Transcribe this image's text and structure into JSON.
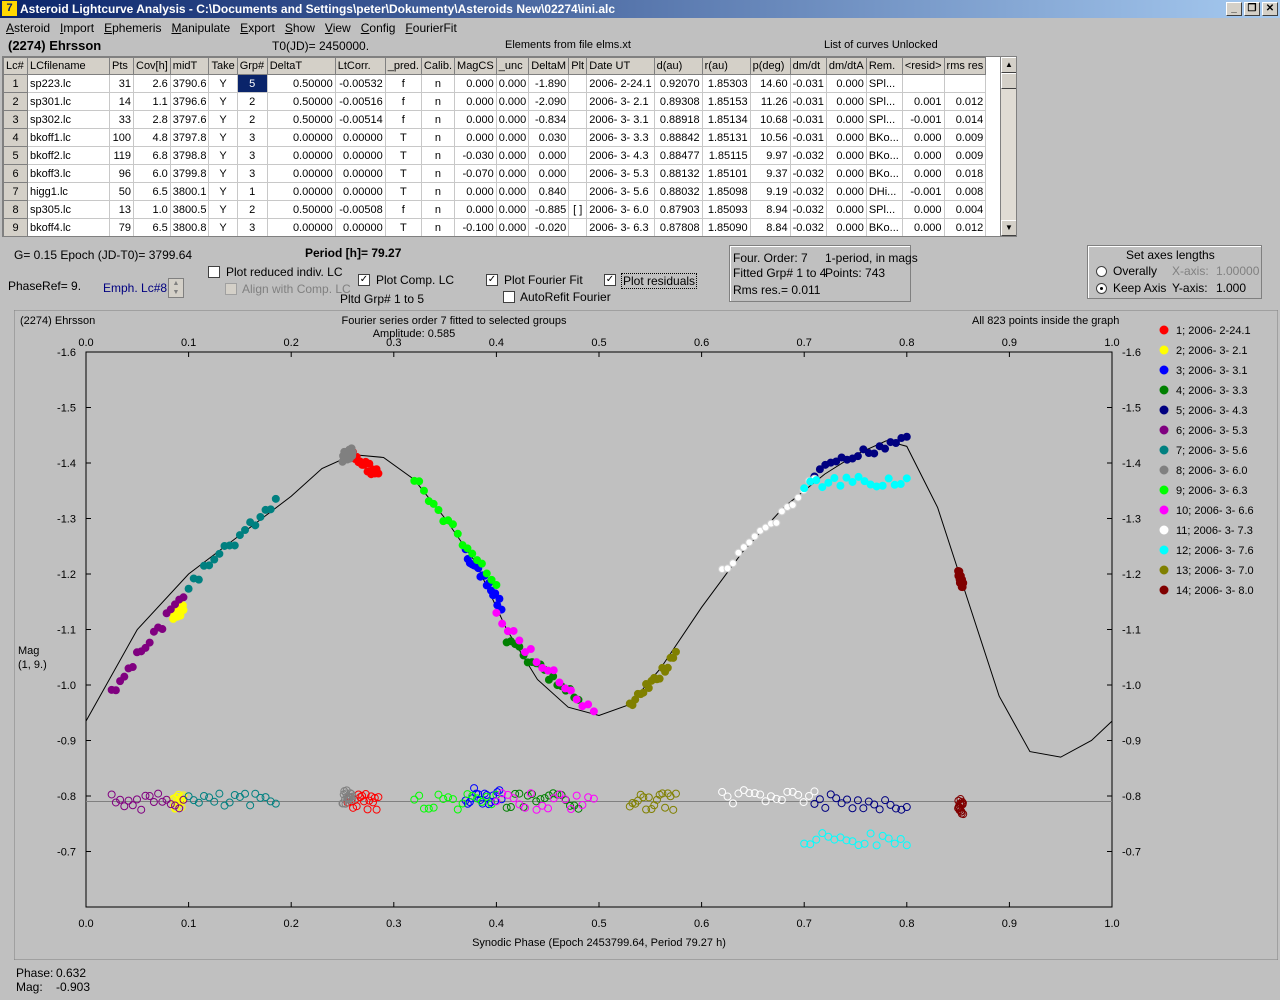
{
  "window": {
    "title": "Asteroid Lightcurve Analysis - C:\\Documents and Settings\\peter\\Dokumenty\\Asteroids New\\02274\\ini.alc",
    "icon_label": "7",
    "minimize": "_",
    "restore": "❐",
    "close": "✕"
  },
  "menu": [
    "Asteroid",
    "Import",
    "Ephemeris",
    "Manipulate",
    "Export",
    "Show",
    "View",
    "Config",
    "FourierFit"
  ],
  "header": {
    "asteroid": "(2274) Ehrsson",
    "t0": "T0(JD)= 2450000.",
    "elements": "Elements from file elms.xt",
    "curves": "List of curves Unlocked"
  },
  "table": {
    "columns": [
      "Lc#",
      "LCfilename",
      "Pts",
      "Cov[h]",
      "midT",
      "Take",
      "Grp#",
      "DeltaT",
      "LtCorr.",
      "_pred.",
      "Calib.",
      "MagCS",
      "_unc",
      "DeltaM",
      "Plt",
      "Date UT",
      "d(au)",
      "r(au)",
      "p(deg)",
      "dm/dt",
      "dm/dtA",
      "Rem.",
      "<resid>",
      "rms res"
    ],
    "rows": [
      [
        "1",
        "sp223.lc",
        "31",
        "2.6",
        "3790.6",
        "Y",
        "5",
        "0.50000",
        "-0.00532",
        "f",
        "n",
        "0.000",
        "0.000",
        "-1.890",
        "",
        "2006- 2-24.1",
        "0.92070",
        "1.85303",
        "14.60",
        "-0.031",
        "0.000",
        "SPl...",
        "",
        ""
      ],
      [
        "2",
        "sp301.lc",
        "14",
        "1.1",
        "3796.6",
        "Y",
        "2",
        "0.50000",
        "-0.00516",
        "f",
        "n",
        "0.000",
        "0.000",
        "-2.090",
        "",
        "2006- 3- 2.1",
        "0.89308",
        "1.85153",
        "11.26",
        "-0.031",
        "0.000",
        "SPl...",
        "0.001",
        "0.012"
      ],
      [
        "3",
        "sp302.lc",
        "33",
        "2.8",
        "3797.6",
        "Y",
        "2",
        "0.50000",
        "-0.00514",
        "f",
        "n",
        "0.000",
        "0.000",
        "-0.834",
        "",
        "2006- 3- 3.1",
        "0.88918",
        "1.85134",
        "10.68",
        "-0.031",
        "0.000",
        "SPl...",
        "-0.001",
        "0.014"
      ],
      [
        "4",
        "bkoff1.lc",
        "100",
        "4.8",
        "3797.8",
        "Y",
        "3",
        "0.00000",
        "0.00000",
        "T",
        "n",
        "0.000",
        "0.000",
        "0.030",
        "",
        "2006- 3- 3.3",
        "0.88842",
        "1.85131",
        "10.56",
        "-0.031",
        "0.000",
        "BKo...",
        "0.000",
        "0.009"
      ],
      [
        "5",
        "bkoff2.lc",
        "119",
        "6.8",
        "3798.8",
        "Y",
        "3",
        "0.00000",
        "0.00000",
        "T",
        "n",
        "-0.030",
        "0.000",
        "0.000",
        "",
        "2006- 3- 4.3",
        "0.88477",
        "1.85115",
        "9.97",
        "-0.032",
        "0.000",
        "BKo...",
        "0.000",
        "0.009"
      ],
      [
        "6",
        "bkoff3.lc",
        "96",
        "6.0",
        "3799.8",
        "Y",
        "3",
        "0.00000",
        "0.00000",
        "T",
        "n",
        "-0.070",
        "0.000",
        "0.000",
        "",
        "2006- 3- 5.3",
        "0.88132",
        "1.85101",
        "9.37",
        "-0.032",
        "0.000",
        "BKo...",
        "0.000",
        "0.018"
      ],
      [
        "7",
        "higg1.lc",
        "50",
        "6.5",
        "3800.1",
        "Y",
        "1",
        "0.00000",
        "0.00000",
        "T",
        "n",
        "0.000",
        "0.000",
        "0.840",
        "",
        "2006- 3- 5.6",
        "0.88032",
        "1.85098",
        "9.19",
        "-0.032",
        "0.000",
        "DHi...",
        "-0.001",
        "0.008"
      ],
      [
        "8",
        "sp305.lc",
        "13",
        "1.0",
        "3800.5",
        "Y",
        "2",
        "0.50000",
        "-0.00508",
        "f",
        "n",
        "0.000",
        "0.000",
        "-0.885",
        "[ ]",
        "2006- 3- 6.0",
        "0.87903",
        "1.85093",
        "8.94",
        "-0.032",
        "0.000",
        "SPl...",
        "0.000",
        "0.004"
      ],
      [
        "9",
        "bkoff4.lc",
        "79",
        "6.5",
        "3800.8",
        "Y",
        "3",
        "0.00000",
        "0.00000",
        "T",
        "n",
        "-0.100",
        "0.000",
        "-0.020",
        "",
        "2006- 3- 6.3",
        "0.87808",
        "1.85090",
        "8.84",
        "-0.032",
        "0.000",
        "BKo...",
        "0.000",
        "0.012"
      ]
    ]
  },
  "controls": {
    "g_epoch": "G= 0.15    Epoch (JD-T0)= 3799.64",
    "period": "Period [h]= 79.27",
    "phaseref": "PhaseRef= 9.",
    "emph": "Emph. Lc#8:",
    "plot_reduced": "Plot reduced indiv. LC",
    "align": "Align with Comp. LC",
    "plot_comp": "Plot Comp. LC",
    "pltd_grp": "Pltd Grp#  1   to   5",
    "plot_fourier": "Plot Fourier Fit",
    "autorefit": "AutoRefit Fourier",
    "plot_residuals": "Plot residuals",
    "check": "✓",
    "spin_up": "▲",
    "spin_down": "▼"
  },
  "fourier_info": {
    "order": "Four. Order:  7",
    "mode": "1-period, in mags",
    "fitted": "Fitted Grp# 1 to 4",
    "points": "Points: 743",
    "rms": "Rms res.= 0.011"
  },
  "axes_box": {
    "title": "Set axes lengths",
    "overally": "Overally",
    "keep": "Keep Axis",
    "xaxis_label": "X-axis:",
    "xaxis_value": "1.00000",
    "yaxis_label": "Y-axis:",
    "yaxis_value": "1.000"
  },
  "readout": {
    "phase_label": "Phase:",
    "phase": "0.632",
    "mag_label": "Mag:",
    "mag": "-0.903"
  },
  "chart_data": {
    "type": "scatter",
    "title": "Fourier series order 7 fitted to selected groups",
    "subtitle": "Amplitude: 0.585",
    "corner_left": "(2274) Ehrsson",
    "corner_right": "All 823 points inside the graph",
    "xlabel": "Synodic Phase (Epoch 2453799.64, Period 79.27 h)",
    "ylabel": "Mag",
    "ylabel2": "(1, 9.)",
    "xlim": [
      0,
      1
    ],
    "ylim": [
      -1.6,
      -0.6
    ],
    "y_inverted": true,
    "xticks": [
      "0.0",
      "0.1",
      "0.2",
      "0.3",
      "0.4",
      "0.5",
      "0.6",
      "0.7",
      "0.8",
      "0.9",
      "1.0"
    ],
    "yticks": [
      "-1.6",
      "-1.5",
      "-1.4",
      "-1.3",
      "-1.2",
      "-1.1",
      "-1.0",
      "-0.9",
      "-0.8",
      "-0.7"
    ],
    "residual_baseline": -0.79,
    "fourier_curve": [
      [
        0,
        -0.935
      ],
      [
        0.05,
        -1.1
      ],
      [
        0.1,
        -1.2
      ],
      [
        0.15,
        -1.27
      ],
      [
        0.2,
        -1.34
      ],
      [
        0.23,
        -1.39
      ],
      [
        0.26,
        -1.415
      ],
      [
        0.29,
        -1.41
      ],
      [
        0.32,
        -1.37
      ],
      [
        0.35,
        -1.3
      ],
      [
        0.38,
        -1.22
      ],
      [
        0.41,
        -1.1
      ],
      [
        0.44,
        -1.01
      ],
      [
        0.47,
        -0.96
      ],
      [
        0.5,
        -0.945
      ],
      [
        0.53,
        -0.965
      ],
      [
        0.56,
        -1.03
      ],
      [
        0.6,
        -1.14
      ],
      [
        0.64,
        -1.24
      ],
      [
        0.68,
        -1.32
      ],
      [
        0.72,
        -1.38
      ],
      [
        0.75,
        -1.415
      ],
      [
        0.78,
        -1.44
      ],
      [
        0.8,
        -1.43
      ],
      [
        0.83,
        -1.32
      ],
      [
        0.86,
        -1.15
      ],
      [
        0.89,
        -0.98
      ],
      [
        0.92,
        -0.88
      ],
      [
        0.95,
        -0.87
      ],
      [
        0.98,
        -0.9
      ],
      [
        1.0,
        -0.935
      ]
    ],
    "series": [
      {
        "name": "1; 2006- 2-24.1",
        "color": "#ff0000",
        "x": [
          0.255,
          0.285
        ],
        "y": [
          -1.418,
          -1.38
        ],
        "res": -0.79
      },
      {
        "name": "2; 2006- 3- 2.1",
        "color": "#ffff00",
        "x": [
          0.085,
          0.095
        ],
        "y": [
          -1.12,
          -1.14
        ],
        "res": -0.79
      },
      {
        "name": "3; 2006- 3- 3.1",
        "color": "#0000ff",
        "x": [
          0.37,
          0.405
        ],
        "y": [
          -1.24,
          -1.14
        ],
        "res": -0.8
      },
      {
        "name": "4; 2006- 3- 3.3",
        "color": "#008000",
        "x": [
          0.41,
          0.48
        ],
        "y": [
          -1.08,
          -0.97
        ],
        "res": -0.79
      },
      {
        "name": "5; 2006- 3- 4.3",
        "color": "#000080",
        "x": [
          0.71,
          0.8
        ],
        "y": [
          -1.38,
          -1.45
        ],
        "res": -0.79
      },
      {
        "name": "6; 2006- 3- 5.3",
        "color": "#800080",
        "x": [
          0.025,
          0.095
        ],
        "y": [
          -0.99,
          -1.16
        ],
        "res": -0.79
      },
      {
        "name": "7; 2006- 3- 5.6",
        "color": "#008080",
        "x": [
          0.1,
          0.185
        ],
        "y": [
          -1.18,
          -1.33
        ],
        "res": -0.79
      },
      {
        "name": "8; 2006- 3- 6.0",
        "color": "#808080",
        "x": [
          0.25,
          0.26
        ],
        "y": [
          -1.41,
          -1.42
        ],
        "res": -0.8
      },
      {
        "name": "9; 2006- 3- 6.3",
        "color": "#00ff00",
        "x": [
          0.32,
          0.4
        ],
        "y": [
          -1.37,
          -1.18
        ],
        "res": -0.79
      },
      {
        "name": "10; 2006- 3- 6.6",
        "color": "#ff00ff",
        "x": [
          0.4,
          0.495
        ],
        "y": [
          -1.12,
          -0.945
        ],
        "res": -0.79
      },
      {
        "name": "11; 2006- 3- 7.3",
        "color": "#ffffff",
        "x": [
          0.62,
          0.71
        ],
        "y": [
          -1.2,
          -1.37
        ],
        "res": -0.8
      },
      {
        "name": "12; 2006- 3- 7.6",
        "color": "#00ffff",
        "x": [
          0.7,
          0.8
        ],
        "y": [
          -1.36,
          -1.37
        ],
        "res": -0.72
      },
      {
        "name": "13; 2006- 3- 7.0",
        "color": "#808000",
        "x": [
          0.53,
          0.575
        ],
        "y": [
          -0.96,
          -1.05
        ],
        "res": -0.79
      },
      {
        "name": "14; 2006- 3- 8.0",
        "color": "#800000",
        "x": [
          0.85,
          0.855
        ],
        "y": [
          -1.2,
          -1.18
        ],
        "res": -0.78
      }
    ]
  }
}
